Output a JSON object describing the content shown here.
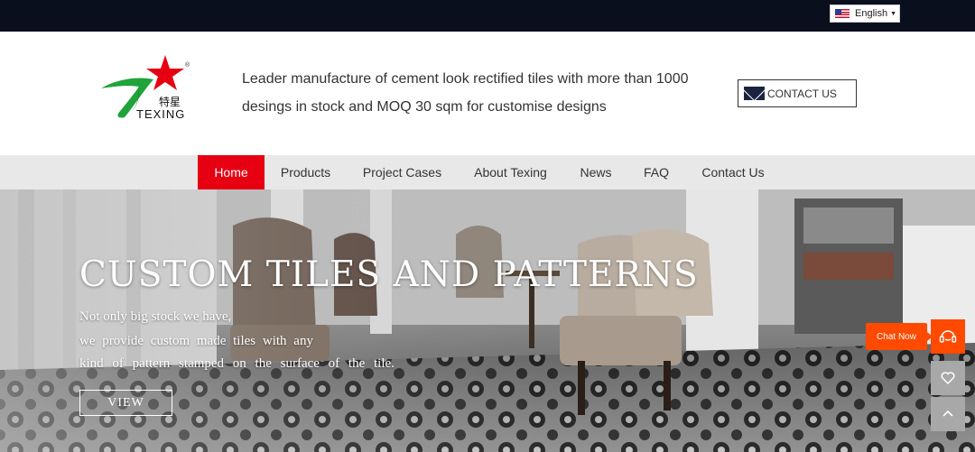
{
  "topbar": {
    "language": "English"
  },
  "header": {
    "logo_cn": "特星",
    "logo_en": "TEXING",
    "logo_reg": "®",
    "tagline_line1": "Leader manufacture of cement look rectified tiles with more than 1000",
    "tagline_line2": "desings in stock and MOQ 30 sqm for customise designs",
    "contact_label": "CONTACT US"
  },
  "nav": {
    "items": [
      {
        "label": "Home"
      },
      {
        "label": "Products"
      },
      {
        "label": "Project Cases"
      },
      {
        "label": "About Texing"
      },
      {
        "label": "News"
      },
      {
        "label": "FAQ"
      },
      {
        "label": "Contact Us"
      }
    ]
  },
  "hero": {
    "title": "CUSTOM TILES AND PATTERNS",
    "line1": "Not only big stock we have,",
    "line2": "we provide custom made tiles with any",
    "line3": "kind of pattern stamped on the surface of the tile.",
    "view_label": "VIEW"
  },
  "side": {
    "chat_label": "Chat Now"
  },
  "colors": {
    "accent": "#e60012",
    "chat": "#ff4a00",
    "topbar": "#0a0f1e",
    "nav_bg": "#e8e8e8"
  }
}
